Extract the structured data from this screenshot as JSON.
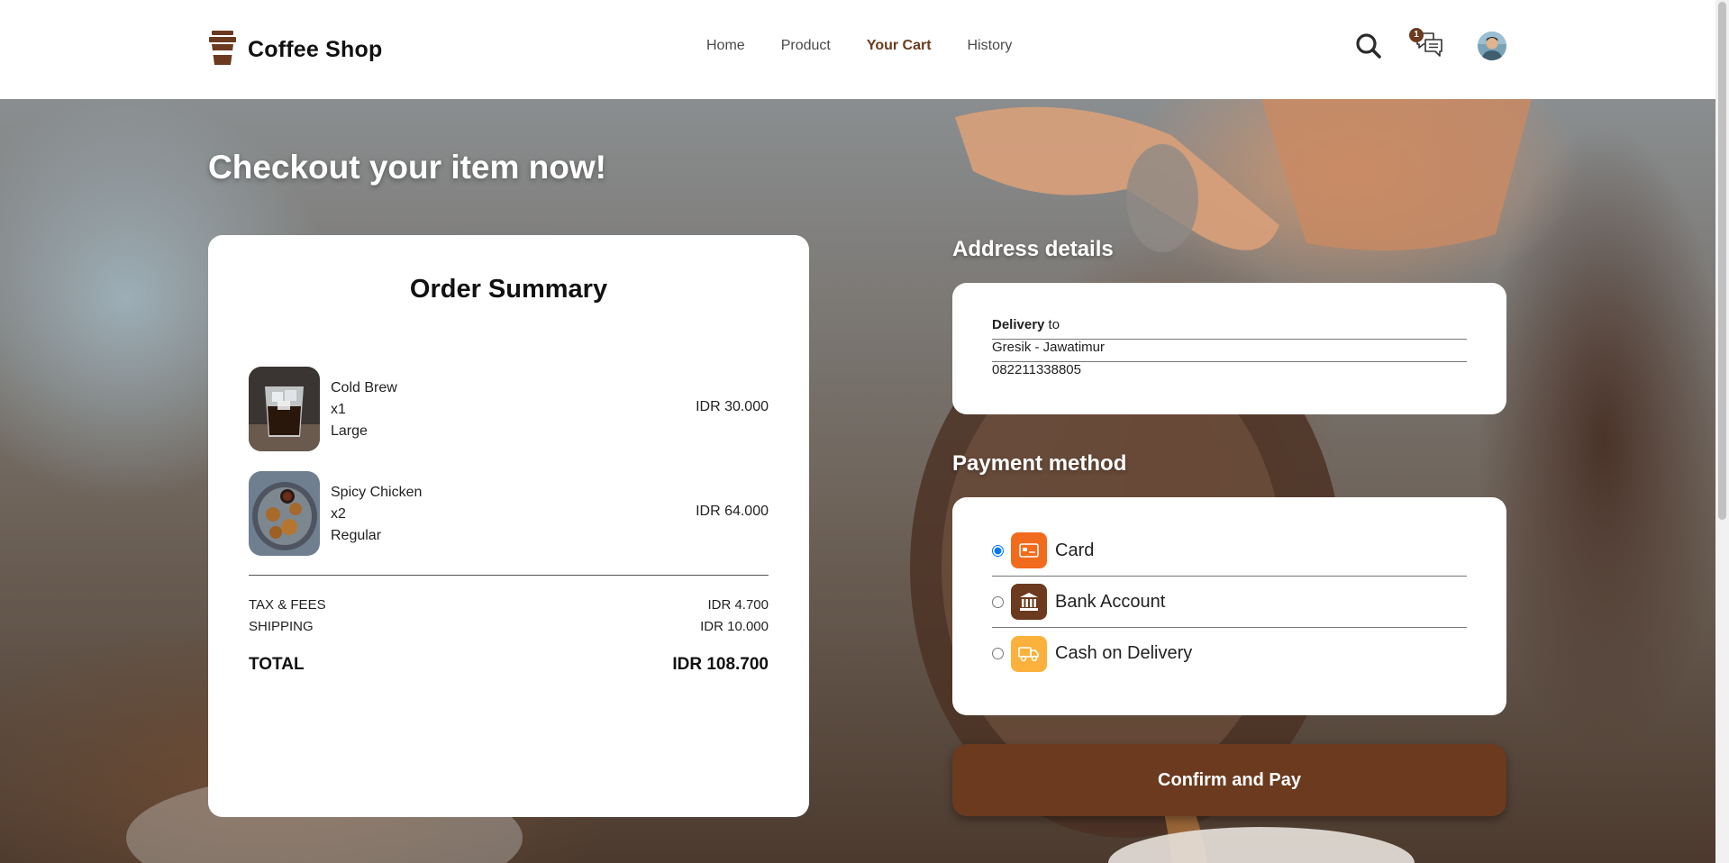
{
  "header": {
    "brand": "Coffee Shop",
    "nav": [
      {
        "label": "Home",
        "active": false
      },
      {
        "label": "Product",
        "active": false
      },
      {
        "label": "Your Cart",
        "active": true
      },
      {
        "label": "History",
        "active": false
      }
    ],
    "chat_badge": "1",
    "icons": [
      "coffee-cup-icon",
      "search-icon",
      "chat-icon",
      "avatar"
    ]
  },
  "main": {
    "headline": "Checkout your item now!"
  },
  "order_summary": {
    "title": "Order Summary",
    "items": [
      {
        "name": "Cold Brew",
        "qty": "x1",
        "size": "Large",
        "price": "IDR 30.000"
      },
      {
        "name": "Spicy Chicken",
        "qty": "x2",
        "size": "Regular",
        "price": "IDR 64.000"
      }
    ],
    "tax_label": "TAX & FEES",
    "tax_value": "IDR 4.700",
    "shipping_label": "SHIPPING",
    "shipping_value": "IDR 10.000",
    "total_label": "TOTAL",
    "total_value": "IDR 108.700"
  },
  "address": {
    "title": "Address details",
    "delivery_bold": "Delivery",
    "delivery_rest": " to",
    "location": "Gresik - Jawatimur",
    "phone": "082211338805"
  },
  "payment": {
    "title": "Payment method",
    "options": [
      {
        "label": "Card",
        "selected": true,
        "color": "#f26b1d",
        "icon": "card-icon"
      },
      {
        "label": "Bank Account",
        "selected": false,
        "color": "#6b3a1f",
        "icon": "bank-icon"
      },
      {
        "label": "Cash on Delivery",
        "selected": false,
        "color": "#fbb13c",
        "icon": "truck-icon"
      }
    ],
    "confirm_label": "Confirm and Pay"
  },
  "colors": {
    "brand_brown": "#6b3a1f",
    "card_orange": "#f26b1d",
    "cod_yellow": "#fbb13c"
  }
}
